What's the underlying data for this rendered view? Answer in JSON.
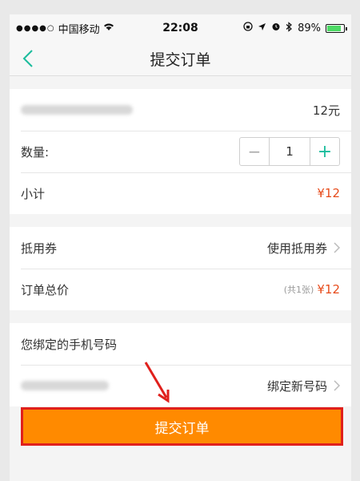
{
  "status_bar": {
    "carrier": "中国移动",
    "time": "22:08",
    "battery": "89%"
  },
  "nav": {
    "title": "提交订单"
  },
  "order": {
    "item_price": "12元",
    "quantity_label": "数量:",
    "minus_symbol": "−",
    "quantity_value": "1",
    "plus_symbol": "+",
    "subtotal_label": "小计",
    "subtotal_value": "¥12"
  },
  "voucher": {
    "label": "抵用券",
    "action": "使用抵用券"
  },
  "total": {
    "label": "订单总价",
    "count_note": "(共1张)",
    "value": "¥12"
  },
  "phone_binding": {
    "label": "您绑定的手机号码",
    "action": "绑定新号码"
  },
  "submit": {
    "label": "提交订单"
  },
  "colors": {
    "accent_green": "#1abc9c",
    "price_red": "#e74c1c",
    "submit_orange": "#ff8a00",
    "annotation_red": "#e0201c"
  }
}
